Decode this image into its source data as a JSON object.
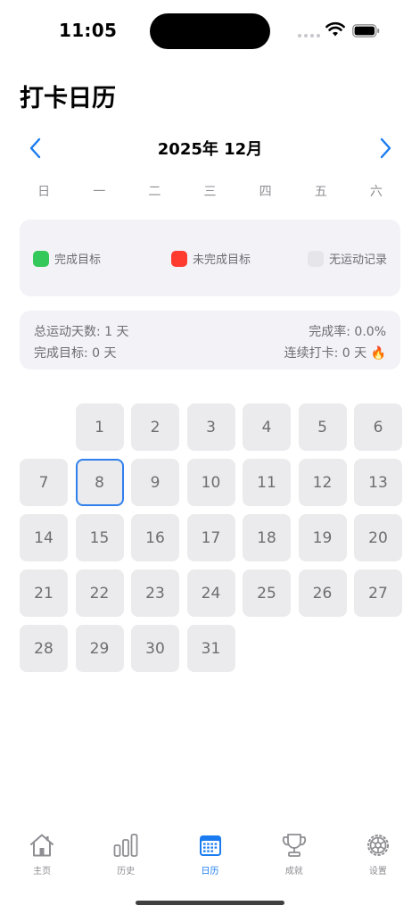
{
  "status_bar": {
    "time": "11:05"
  },
  "page_title": "打卡日历",
  "month_nav": {
    "title": "2025年 12月"
  },
  "weekdays": [
    "日",
    "一",
    "二",
    "三",
    "四",
    "五",
    "六"
  ],
  "legend": [
    {
      "label": "完成目标",
      "color": "#34c759"
    },
    {
      "label": "未完成目标",
      "color": "#ff3b30"
    },
    {
      "label": "无运动记录",
      "color": "#e5e5ea"
    }
  ],
  "stats": {
    "total_days": "总运动天数: 1 天",
    "completion_rate": "完成率: 0.0%",
    "goal_days": "完成目标: 0 天",
    "streak": "连续打卡: 0 天 🔥"
  },
  "calendar": {
    "leading_blank_days": 1,
    "selected_day": 8,
    "days": [
      "1",
      "2",
      "3",
      "4",
      "5",
      "6",
      "7",
      "8",
      "9",
      "10",
      "11",
      "12",
      "13",
      "14",
      "15",
      "16",
      "17",
      "18",
      "19",
      "20",
      "21",
      "22",
      "23",
      "24",
      "25",
      "26",
      "27",
      "28",
      "29",
      "30",
      "31"
    ]
  },
  "tabs": [
    {
      "label": "主页",
      "icon": "house-icon"
    },
    {
      "label": "历史",
      "icon": "bar-chart-icon"
    },
    {
      "label": "日历",
      "icon": "calendar-icon",
      "active": true
    },
    {
      "label": "成就",
      "icon": "trophy-icon"
    },
    {
      "label": "设置",
      "icon": "gear-icon"
    }
  ],
  "colors": {
    "accent": "#1a7cf0",
    "today_border": "#2f80ed",
    "card_bg": "#f2f2f7",
    "day_bg": "#ebebed"
  }
}
